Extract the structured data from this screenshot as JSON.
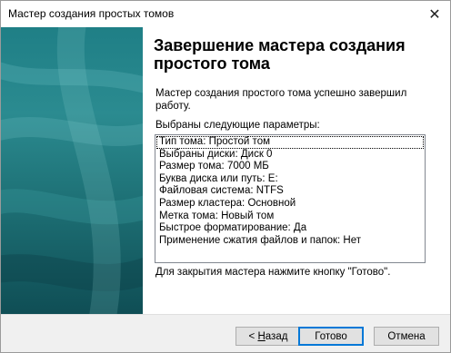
{
  "window": {
    "title": "Мастер создания простых томов",
    "close_glyph": "✕"
  },
  "main": {
    "heading": "Завершение мастера создания простого тома",
    "description": "Мастер создания простого тома успешно завершил работу.",
    "params_label": "Выбраны следующие параметры:",
    "params": [
      "Тип тома: Простой том",
      "Выбраны диски: Диск 0",
      "Размер тома: 7000 МБ",
      "Буква диска или путь: E:",
      "Файловая система: NTFS",
      "Размер кластера: Основной",
      "Метка тома: Новый том",
      "Быстрое форматирование: Да",
      "Применение сжатия файлов и папок: Нет"
    ],
    "footer": "Для закрытия мастера нажмите кнопку \"Готово\"."
  },
  "buttons": {
    "back_prefix": "< ",
    "back_accel": "Н",
    "back_rest": "азад",
    "finish": "Готово",
    "cancel": "Отмена"
  },
  "colors": {
    "side_panel": "#1f7f86",
    "default_button_border": "#0078d7"
  }
}
